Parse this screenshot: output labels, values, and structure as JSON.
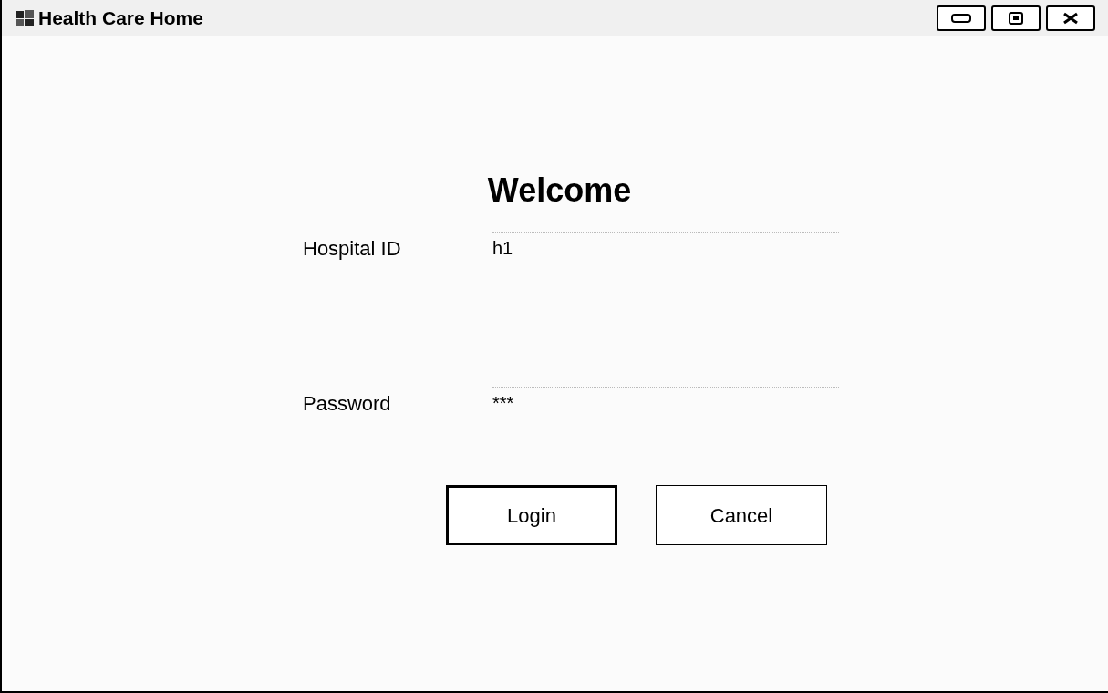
{
  "window": {
    "title": "Health Care Home"
  },
  "heading": "Welcome",
  "fields": [
    {
      "label": "Hospital ID",
      "value": "h1"
    },
    {
      "label": "Password",
      "value": "***"
    }
  ],
  "buttons": [
    {
      "label": "Login",
      "default": true
    },
    {
      "label": "Cancel",
      "default": false
    }
  ]
}
